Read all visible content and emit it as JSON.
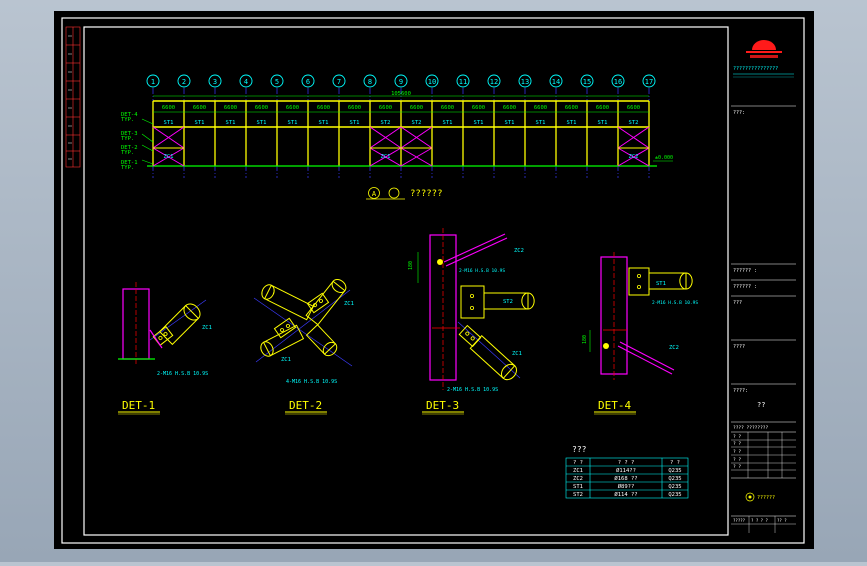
{
  "colors": {
    "background": "#000000",
    "frame": "#ffffff",
    "column": "#ff00ff",
    "beam": "#ffff00",
    "gusset": "#ffff00",
    "dim": "#00ff00",
    "label": "#00ffff",
    "axis": "#3b3bff",
    "accent": "#ff0000"
  },
  "elevation": {
    "axes": [
      "1",
      "2",
      "3",
      "4",
      "5",
      "6",
      "7",
      "8",
      "9",
      "10",
      "11",
      "12",
      "13",
      "14",
      "15",
      "16",
      "17"
    ],
    "bay_dims": [
      "6600",
      "6600",
      "6600",
      "6600",
      "6600",
      "6600",
      "6600",
      "6600",
      "6600",
      "6600",
      "6600",
      "6600",
      "6600",
      "6600",
      "6600",
      "6600"
    ],
    "total_dim": "105600",
    "bay_labels": [
      "ST1",
      "ST1",
      "ST1",
      "ST1",
      "ST1",
      "ST1",
      "ST1",
      "ST2",
      "ST2",
      "ST1",
      "ST1",
      "ST1",
      "ST1",
      "ST1",
      "ST1",
      "ST2"
    ],
    "lower_labels": [
      "ZC1",
      "ZC1",
      "ZC2"
    ],
    "det_labels": [
      "DET-4",
      "TYP.",
      "DET-3",
      "TYP.",
      "DET-2",
      "TYP.",
      "DET-1",
      "TYP."
    ],
    "level_label": "±0.000",
    "title_symbol": "A",
    "title_text": "??????"
  },
  "details": {
    "det1": {
      "title": "DET-1",
      "part": "ZC1",
      "bolt": "2-M16 H.S.B 10.9S"
    },
    "det2": {
      "title": "DET-2",
      "part_a": "ZC1",
      "part_b": "ZC1",
      "bolt": "4-M16 H.S.B 10.9S"
    },
    "det3": {
      "title": "DET-3",
      "part_top": "ZC2",
      "part_beam": "ST2",
      "part_brace": "ZC1",
      "bolt_a": "2-M16 H.S.B 10.9S",
      "bolt_b": "2-M16 H.S.B 10.9S",
      "dim": "180"
    },
    "det4": {
      "title": "DET-4",
      "part_beam": "ST1",
      "part_brace": "ZC2",
      "bolt": "2-M16 H.S.B 10.9S",
      "dim": "180"
    }
  },
  "material_table": {
    "title": "???",
    "header": [
      "? ?",
      "? ? ?",
      "? ?"
    ],
    "rows": [
      [
        "ZC1",
        "Ø114??",
        "Q235"
      ],
      [
        "ZC2",
        "Ø168 ??",
        "Q235"
      ],
      [
        "ST1",
        "Ø89??",
        "Q235"
      ],
      [
        "ST2",
        "Ø114 ??",
        "Q235"
      ]
    ]
  },
  "title_block": {
    "company_line": "???????????????",
    "project_label": "???:",
    "field_1": "?????? :",
    "field_2": "?????? :",
    "field_3": "???",
    "field_4": "????",
    "drawing_label": "????:",
    "drawing_name": "??",
    "sub_header": "????  ????????",
    "rows": [
      "? ?",
      "? ?",
      "? ?",
      "? ?",
      "? ?"
    ],
    "stamp_text": "??????",
    "bottom_cells": [
      "?????",
      "? ? ? ?",
      "?? ?"
    ]
  }
}
